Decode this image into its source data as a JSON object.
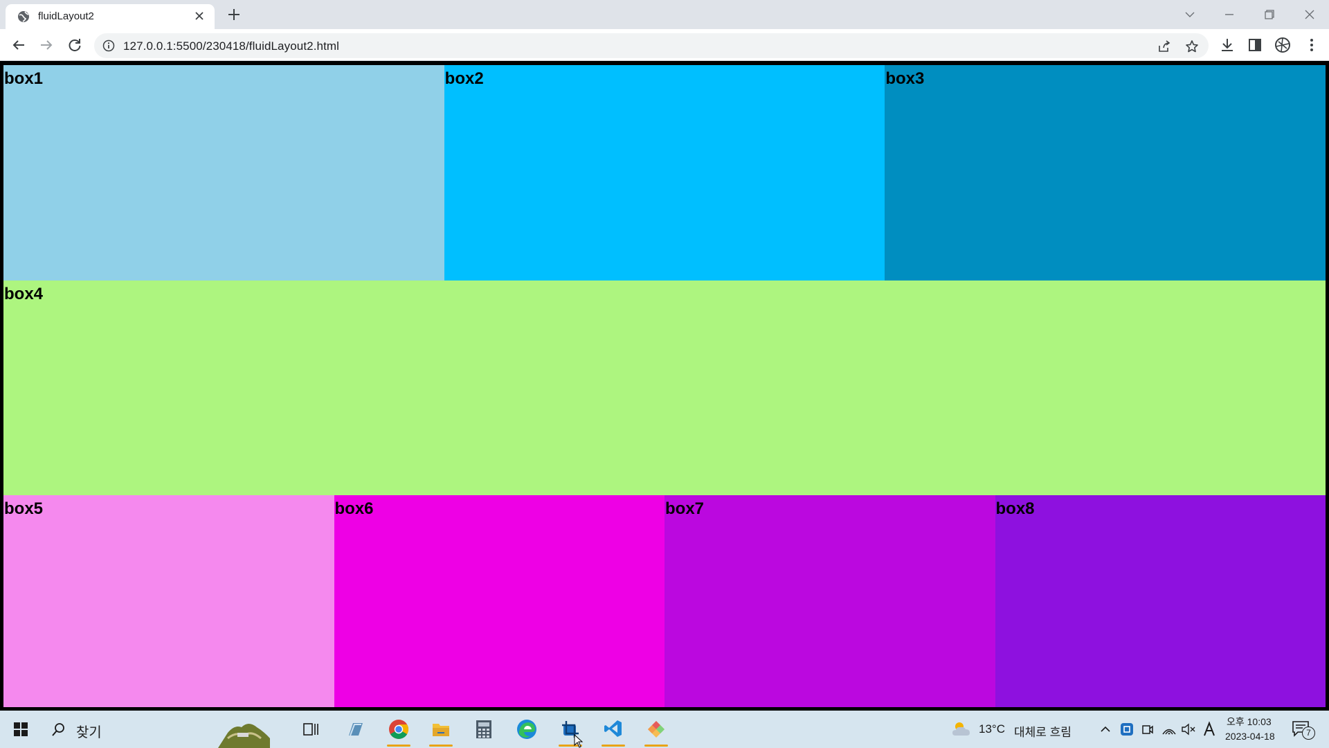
{
  "browser": {
    "tab_title": "fluidLayout2",
    "url": "127.0.0.1:5500/230418/fluidLayout2.html"
  },
  "page": {
    "rows": [
      {
        "boxes": [
          {
            "label": "box1",
            "color": "#90d0e8"
          },
          {
            "label": "box2",
            "color": "#00bfff"
          },
          {
            "label": "box3",
            "color": "#008ec0"
          }
        ]
      },
      {
        "boxes": [
          {
            "label": "box4",
            "color": "#adf57f"
          }
        ]
      },
      {
        "boxes": [
          {
            "label": "box5",
            "color": "#f589ee"
          },
          {
            "label": "box6",
            "color": "#ee00e5"
          },
          {
            "label": "box7",
            "color": "#bb08df"
          },
          {
            "label": "box8",
            "color": "#8e11df"
          }
        ]
      }
    ]
  },
  "taskbar": {
    "search_label": "찾기",
    "weather_temp": "13°C",
    "weather_desc": "대체로 흐림",
    "time": "오후 10:03",
    "date": "2023-04-18",
    "notification_count": "7"
  }
}
